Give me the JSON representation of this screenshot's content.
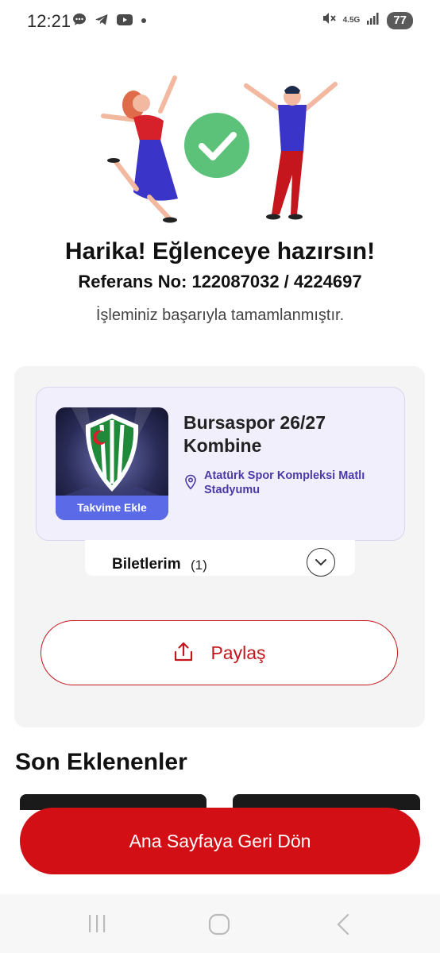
{
  "status_bar": {
    "time": "12:21",
    "network": "4.5G",
    "battery": "77"
  },
  "confirmation": {
    "title": "Harika! Eğlenceye hazırsın!",
    "reference": "Referans No: 122087032 / 4224697",
    "message": "İşleminiz başarıyla tamamlanmıştır."
  },
  "event": {
    "name": "Bursaspor 26/27 Kombine",
    "venue": "Atatürk Spor Kompleksi Matlı Stadyumu",
    "calendar_button": "Takvime Ekle",
    "tickets_label": "Biletlerim",
    "tickets_count": "(1)",
    "share_label": "Paylaş"
  },
  "recent": {
    "title": "Son Eklenenler"
  },
  "footer": {
    "home_button": "Ana Sayfaya Geri Dön"
  },
  "colors": {
    "brand_red": "#c4161c",
    "success_green": "#5cc27a",
    "card_purple": "#f1effc",
    "calendar_blue": "#5b6be8"
  }
}
